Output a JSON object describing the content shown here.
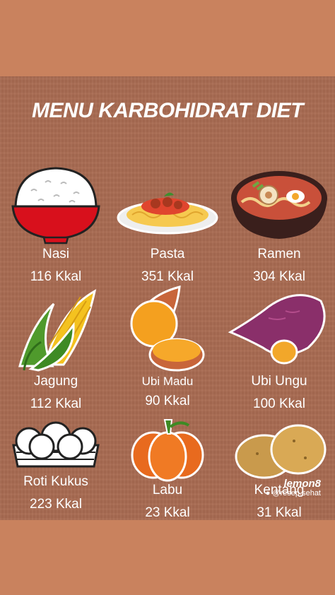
{
  "title": "MENU KARBOHIDRAT DIET",
  "foods": [
    {
      "name": "Nasi",
      "kcal": "116 Kkal",
      "icon": "rice-bowl-icon"
    },
    {
      "name": "Pasta",
      "kcal": "351 Kkal",
      "icon": "pasta-plate-icon"
    },
    {
      "name": "Ramen",
      "kcal": "304 Kkal",
      "icon": "ramen-bowl-icon"
    },
    {
      "name": "Jagung",
      "kcal": "112 Kkal",
      "icon": "corn-icon"
    },
    {
      "name": "Ubi Madu",
      "kcal": "90 Kkal",
      "icon": "honey-sweet-potato-icon"
    },
    {
      "name": "Ubi Ungu",
      "kcal": "100 Kkal",
      "icon": "purple-sweet-potato-icon"
    },
    {
      "name": "Roti Kukus",
      "kcal": "223 Kkal",
      "icon": "steamed-buns-icon"
    },
    {
      "name": "Labu",
      "kcal": "23 Kkal",
      "icon": "pumpkin-icon"
    },
    {
      "name": "Kentang",
      "kcal": "31 Kkal",
      "icon": "potato-icon"
    }
  ],
  "watermark": {
    "logo": "lemon8",
    "handle": "@resep.sehat"
  },
  "colors": {
    "background": "#c9825e",
    "poster": "#a86b52",
    "text": "#ffffff"
  }
}
